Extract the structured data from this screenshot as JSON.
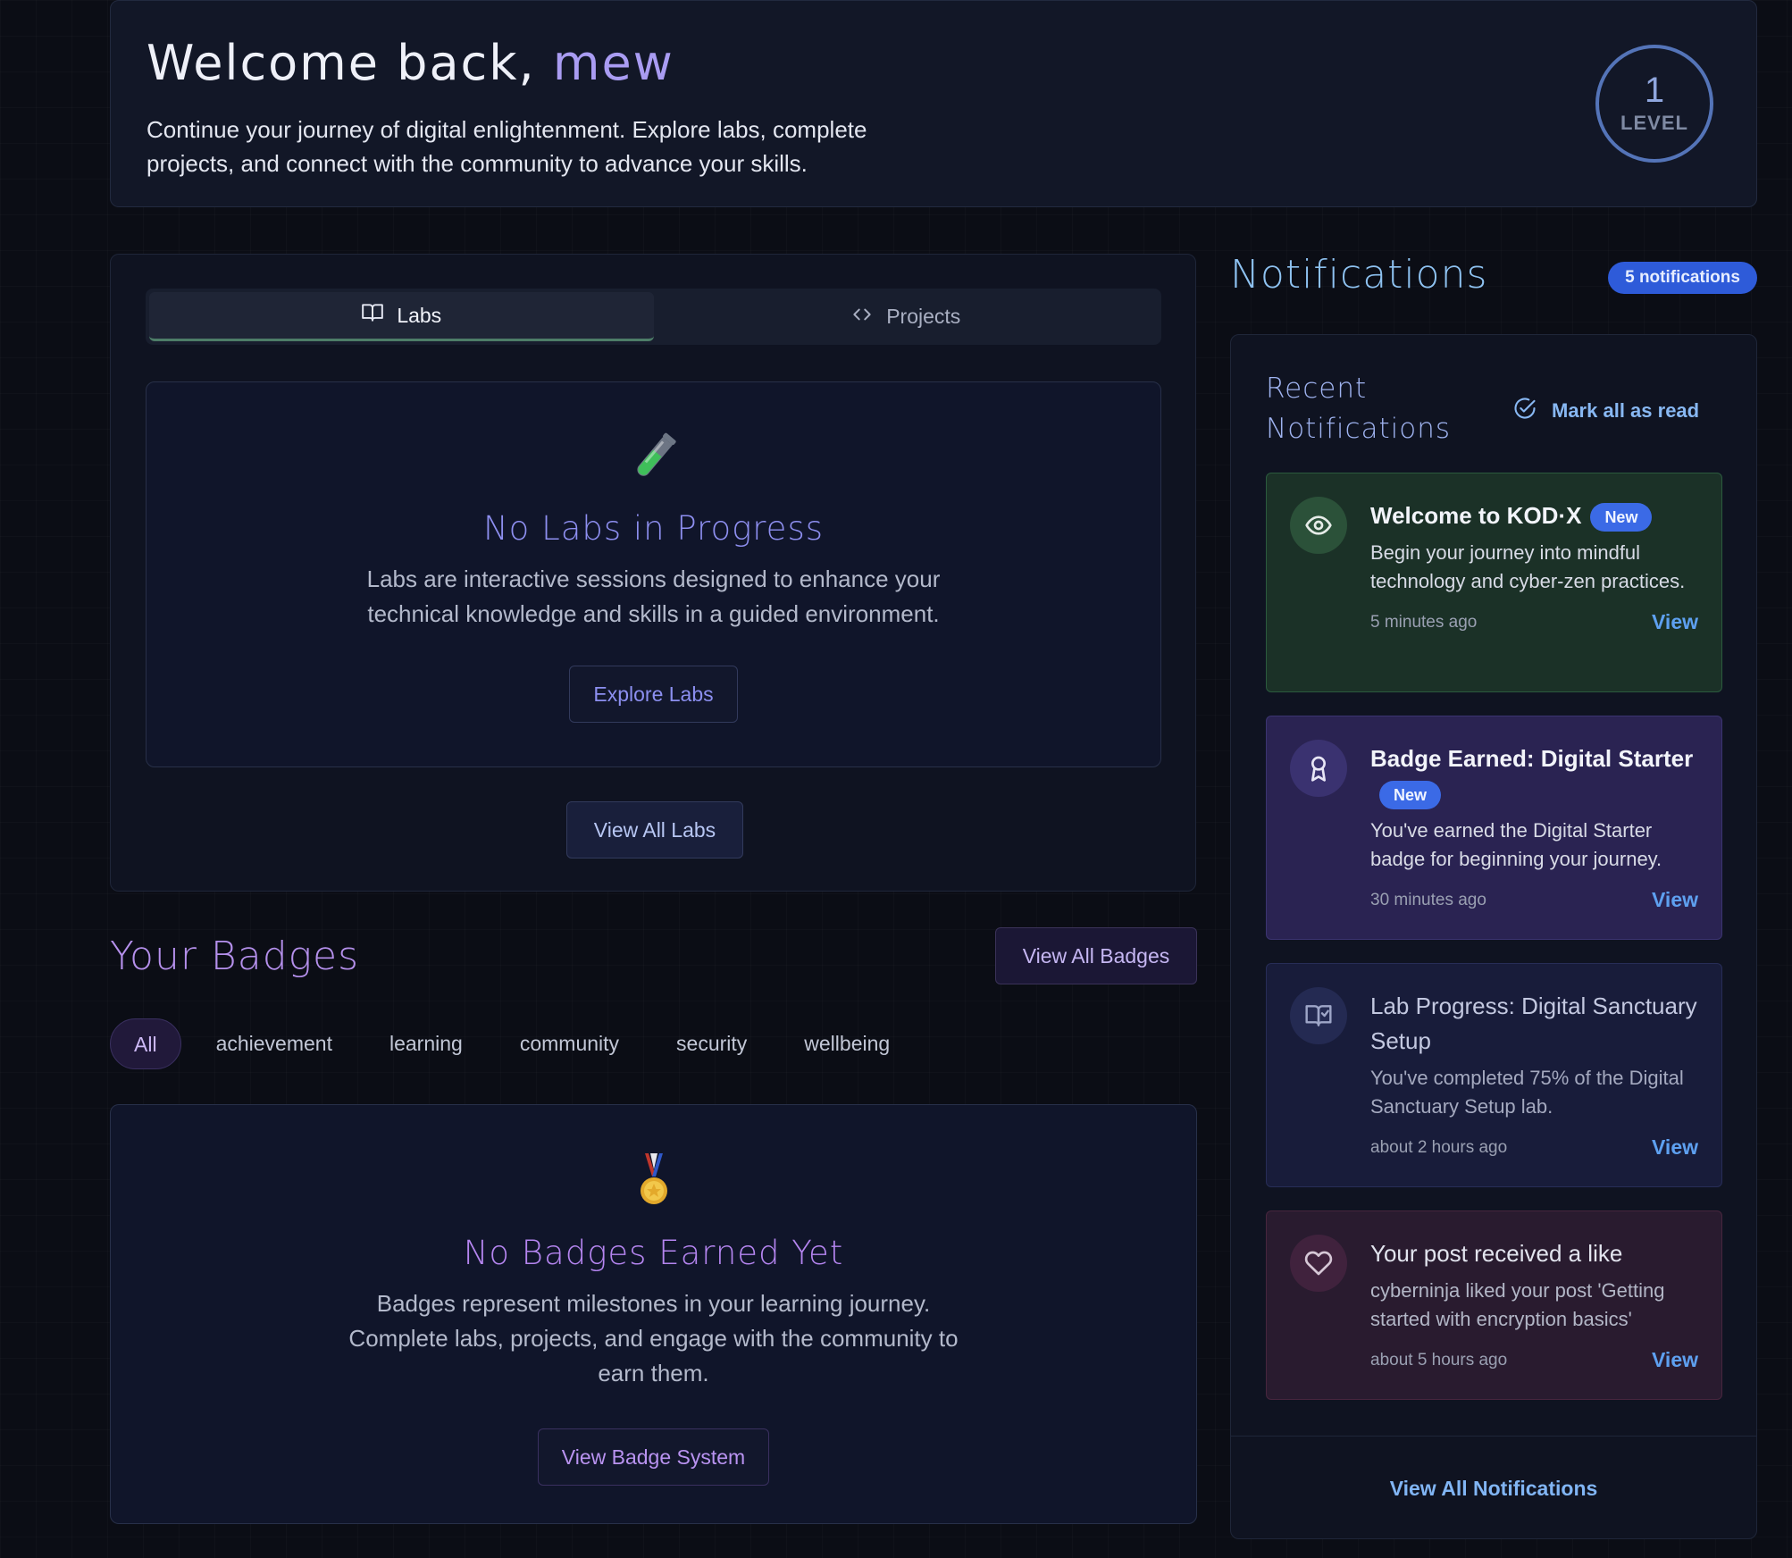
{
  "welcome": {
    "greeting": "Welcome back, ",
    "username": "mew",
    "subtitle": "Continue your journey of digital enlightenment. Explore labs, complete projects, and connect with the community to advance your skills.",
    "level_value": "1",
    "level_label": "LEVEL"
  },
  "tabs": [
    {
      "label": "Labs",
      "icon": "book-icon",
      "active": true
    },
    {
      "label": "Projects",
      "icon": "code-icon",
      "active": false
    }
  ],
  "labs": {
    "empty_emoji": "test-tube",
    "empty_title": "No Labs in Progress",
    "empty_desc": "Labs are interactive sessions designed to enhance your technical knowledge and skills in a guided environment.",
    "explore_button": "Explore Labs",
    "view_all_button": "View All Labs"
  },
  "badges": {
    "title": "Your Badges",
    "view_all_button": "View All Badges",
    "filters": [
      "All",
      "achievement",
      "learning",
      "community",
      "security",
      "wellbeing"
    ],
    "active_filter": "All",
    "empty_emoji": "medal",
    "empty_title": "No Badges Earned Yet",
    "empty_desc": "Badges represent milestones in your learning journey. Complete labs, projects, and engage with the community to earn them.",
    "system_button": "View Badge System"
  },
  "notifications": {
    "title": "Notifications",
    "count_badge": "5 notifications",
    "recent_title": "Recent Notifications",
    "mark_all": "Mark all as read",
    "view_all": "View All Notifications",
    "new_label": "New",
    "view_label": "View",
    "items": [
      {
        "title": "Welcome to KOD·X",
        "is_new": true,
        "body": "Begin your journey into mindful technology and cyber-zen practices.",
        "time": "5 minutes ago",
        "icon": "eye-icon",
        "color": "#1b3127"
      },
      {
        "title": "Badge Earned: Digital Starter",
        "is_new": true,
        "body": "You've earned the Digital Starter badge for beginning your journey.",
        "time": "30 minutes ago",
        "icon": "award-icon",
        "color": "#2a2352"
      },
      {
        "title": "Lab Progress: Digital Sanctuary Setup",
        "is_new": false,
        "body": "You've completed 75% of the Digital Sanctuary Setup lab.",
        "time": "about 2 hours ago",
        "icon": "book-icon",
        "color": "#181c3a"
      },
      {
        "title": "Your post received a like",
        "is_new": false,
        "body": "cyberninja liked your post 'Getting started with encryption basics'",
        "time": "about 5 hours ago",
        "icon": "heart-icon",
        "color": "#291b2f"
      }
    ]
  },
  "colors": {
    "accent_purple": "#a99cf2",
    "accent_blue": "#5ea0f0",
    "new_badge": "#3b6ae6"
  }
}
